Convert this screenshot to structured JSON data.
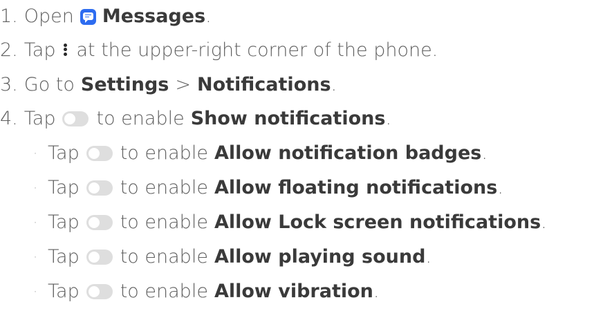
{
  "steps": [
    {
      "number": "1.",
      "text_before": "Open",
      "bold": "Messages",
      "text_after": "."
    },
    {
      "number": "2.",
      "text_before": "Tap",
      "text_after": "at the upper-right corner of the phone."
    },
    {
      "number": "3.",
      "text_before": "Go to",
      "bold1": "Settings",
      "sep": ">",
      "bold2": "Notifications",
      "text_after": "."
    },
    {
      "number": "4.",
      "text_before": "Tap",
      "text_mid": "to enable",
      "bold": "Show notifications",
      "text_after": "."
    }
  ],
  "substeps": [
    {
      "bullet": "·",
      "text_before": "Tap",
      "text_mid": "to enable",
      "bold": "Allow notification badges",
      "text_after": "."
    },
    {
      "bullet": "·",
      "text_before": "Tap",
      "text_mid": "to enable",
      "bold": "Allow floating notifications",
      "text_after": "."
    },
    {
      "bullet": "·",
      "text_before": "Tap",
      "text_mid": "to enable",
      "bold": "Allow Lock screen notifications",
      "text_after": "."
    },
    {
      "bullet": "·",
      "text_before": "Tap",
      "text_mid": "to enable",
      "bold": "Allow playing sound",
      "text_after": "."
    },
    {
      "bullet": "·",
      "text_before": "Tap",
      "text_mid": "to enable",
      "bold": "Allow vibration",
      "text_after": "."
    }
  ],
  "icons": {
    "messages": "messages-app-icon",
    "more": "more-vertical-icon",
    "toggle": "toggle-switch-off-icon"
  },
  "colors": {
    "messages_icon": "#2d6cf0",
    "toggle_off": "#dedede"
  }
}
